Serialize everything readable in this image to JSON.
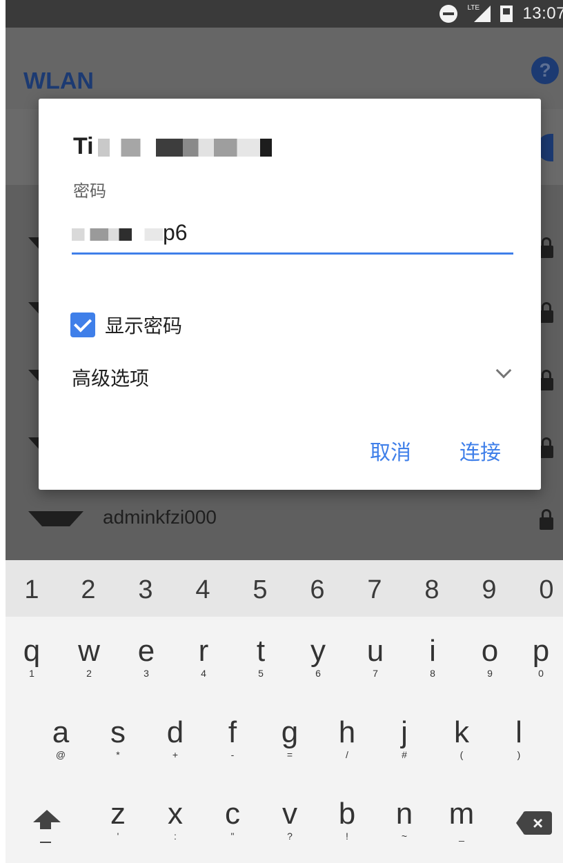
{
  "status_bar": {
    "time": "13:07",
    "network": "LTE"
  },
  "app_bar": {
    "title": "WLAN",
    "help_icon": "?"
  },
  "wifi_list": {
    "visible_ssid": "adminkfzi000"
  },
  "dialog": {
    "network_name_visible": "Ti",
    "password_label": "密码",
    "password_visible_suffix": "p6",
    "show_password_label": "显示密码",
    "show_password_checked": true,
    "advanced_label": "高级选项",
    "cancel_label": "取消",
    "connect_label": "连接",
    "accent_color": "#3f7fe9"
  },
  "keyboard": {
    "numbers": [
      "1",
      "2",
      "3",
      "4",
      "5",
      "6",
      "7",
      "8",
      "9",
      "0"
    ],
    "row1": [
      {
        "k": "q",
        "a": "1"
      },
      {
        "k": "w",
        "a": "2"
      },
      {
        "k": "e",
        "a": "3"
      },
      {
        "k": "r",
        "a": "4"
      },
      {
        "k": "t",
        "a": "5"
      },
      {
        "k": "y",
        "a": "6"
      },
      {
        "k": "u",
        "a": "7"
      },
      {
        "k": "i",
        "a": "8"
      },
      {
        "k": "o",
        "a": "9"
      },
      {
        "k": "p",
        "a": "0"
      }
    ],
    "row2": [
      {
        "k": "a",
        "a": "@"
      },
      {
        "k": "s",
        "a": "*"
      },
      {
        "k": "d",
        "a": "+"
      },
      {
        "k": "f",
        "a": "-"
      },
      {
        "k": "g",
        "a": "="
      },
      {
        "k": "h",
        "a": "/"
      },
      {
        "k": "j",
        "a": "#"
      },
      {
        "k": "k",
        "a": "("
      },
      {
        "k": "l",
        "a": ")"
      }
    ],
    "row3": [
      {
        "k": "z",
        "a": "'"
      },
      {
        "k": "x",
        "a": ":"
      },
      {
        "k": "c",
        "a": "\""
      },
      {
        "k": "v",
        "a": "?"
      },
      {
        "k": "b",
        "a": "!"
      },
      {
        "k": "n",
        "a": "~"
      },
      {
        "k": "m",
        "a": "_"
      }
    ],
    "delete_icon": "backspace-icon",
    "shift_icon": "shift-icon"
  }
}
